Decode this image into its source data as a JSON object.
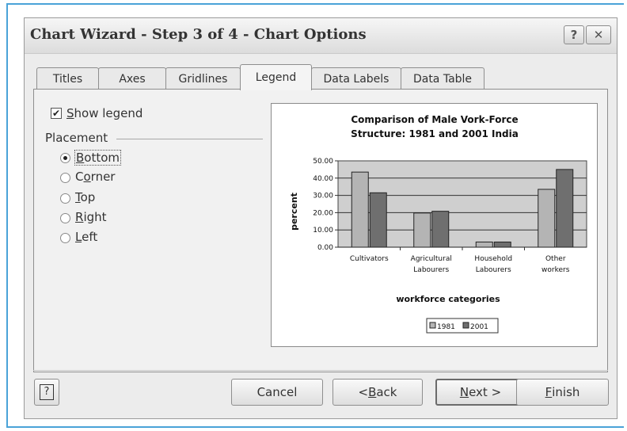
{
  "window": {
    "title": "Chart Wizard - Step 3 of 4 - Chart Options",
    "help_glyph": "?",
    "close_glyph": "✕"
  },
  "tabs": [
    {
      "label": "Titles"
    },
    {
      "label": "Axes"
    },
    {
      "label": "Gridlines"
    },
    {
      "label": "Legend"
    },
    {
      "label": "Data Labels"
    },
    {
      "label": "Data Table"
    }
  ],
  "active_tab": "Legend",
  "legend_options": {
    "show_legend": {
      "label_accel": "S",
      "label_rest": "how legend",
      "checked": true
    },
    "placement_label": "Placement",
    "placements": [
      {
        "accel": "B",
        "rest": "ottom",
        "selected": true
      },
      {
        "pre": "C",
        "accel": "o",
        "rest": "rner",
        "selected": false
      },
      {
        "accel": "T",
        "rest": "op",
        "selected": false
      },
      {
        "accel": "R",
        "rest": "ight",
        "selected": false
      },
      {
        "accel": "L",
        "rest": "eft",
        "selected": false
      }
    ]
  },
  "chart_data": {
    "type": "bar",
    "title_line1": "Comparison of Male Vork-Force",
    "title_line2": "Structure: 1981 and 2001 India",
    "ylabel": "percent",
    "xlabel": "workforce categories",
    "ylim": [
      0,
      50
    ],
    "yticks": [
      "50.00",
      "40.00",
      "30.00",
      "20.00",
      "10.00",
      "0.00"
    ],
    "categories": [
      [
        "Cultivators"
      ],
      [
        "Agricultural",
        "Labourers"
      ],
      [
        "Household",
        "Labourers"
      ],
      [
        "Other",
        "workers"
      ]
    ],
    "series": [
      {
        "name": "1981",
        "values": [
          43.5,
          19.8,
          3.0,
          33.5
        ],
        "color": "#b4b4b4"
      },
      {
        "name": "2001",
        "values": [
          31.5,
          20.8,
          3.0,
          45.0
        ],
        "color": "#6f6f6f"
      }
    ],
    "plot_bg": "#cfcfcf",
    "legend": "bottom"
  },
  "buttons": {
    "help_icon": "?",
    "cancel": "Cancel",
    "back": {
      "pre": "< ",
      "accel": "B",
      "rest": "ack"
    },
    "next": {
      "accel": "N",
      "rest": "ext >"
    },
    "finish": {
      "accel": "F",
      "rest": "inish"
    }
  }
}
